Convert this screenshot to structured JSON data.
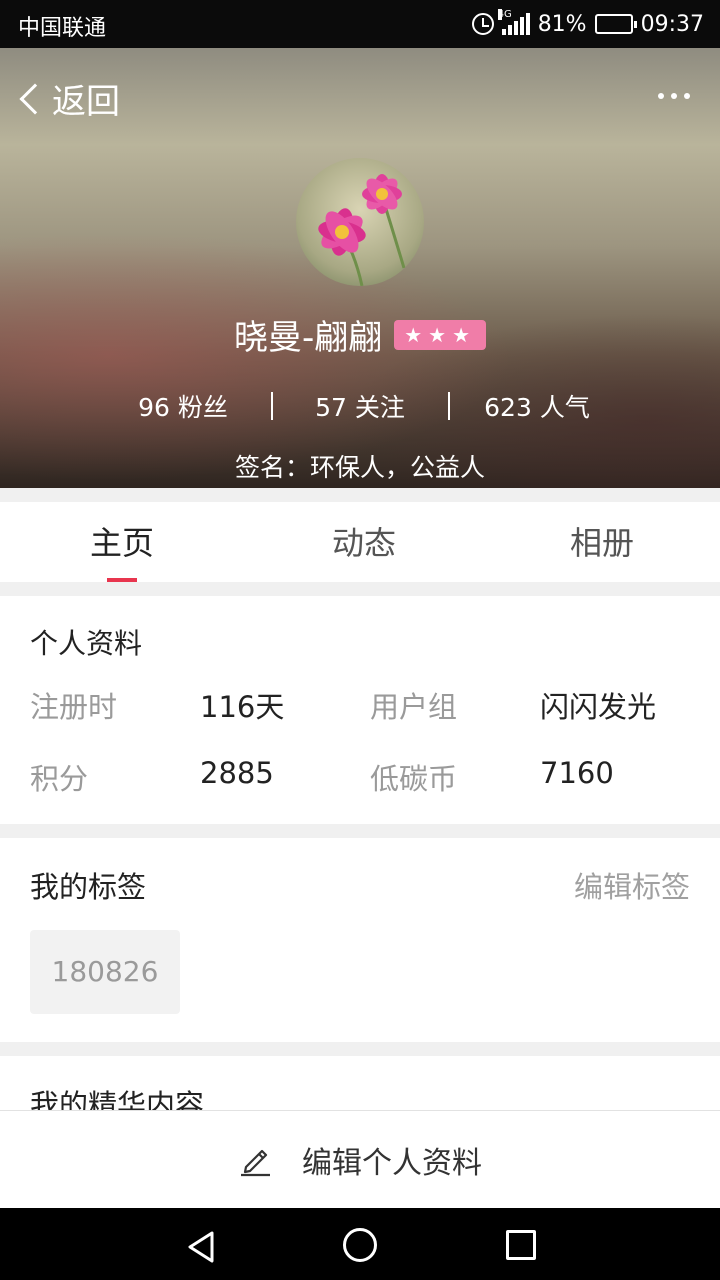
{
  "status_bar": {
    "carrier": "中国联通",
    "network": "4G",
    "battery": "81%",
    "battery_level": 0.81,
    "time": "09:37"
  },
  "header": {
    "back_label": "返回",
    "user_name": "晓曼-翩翩",
    "level_badge": "★★★",
    "stats": [
      {
        "value": "96",
        "label": "粉丝"
      },
      {
        "value": "57",
        "label": "关注"
      },
      {
        "value": "623",
        "label": "人气"
      }
    ],
    "signature": "签名：环保人，公益人"
  },
  "tabs": [
    {
      "label": "主页",
      "active": true
    },
    {
      "label": "动态",
      "active": false
    },
    {
      "label": "相册",
      "active": false
    }
  ],
  "profile": {
    "title": "个人资料",
    "fields": [
      {
        "label": "注册时",
        "value": "116天"
      },
      {
        "label": "用户组",
        "value": "闪闪发光"
      },
      {
        "label": "积分",
        "value": "2885"
      },
      {
        "label": "低碳币",
        "value": "7160"
      }
    ]
  },
  "tags_section": {
    "title": "我的标签",
    "edit_label": "编辑标签",
    "tags": [
      "180826"
    ]
  },
  "essence_section": {
    "title": "我的精华内容"
  },
  "bottom_bar": {
    "edit_label": "编辑个人资料"
  },
  "colors": {
    "accent": "#e8354e",
    "badge": "#f07da8"
  }
}
